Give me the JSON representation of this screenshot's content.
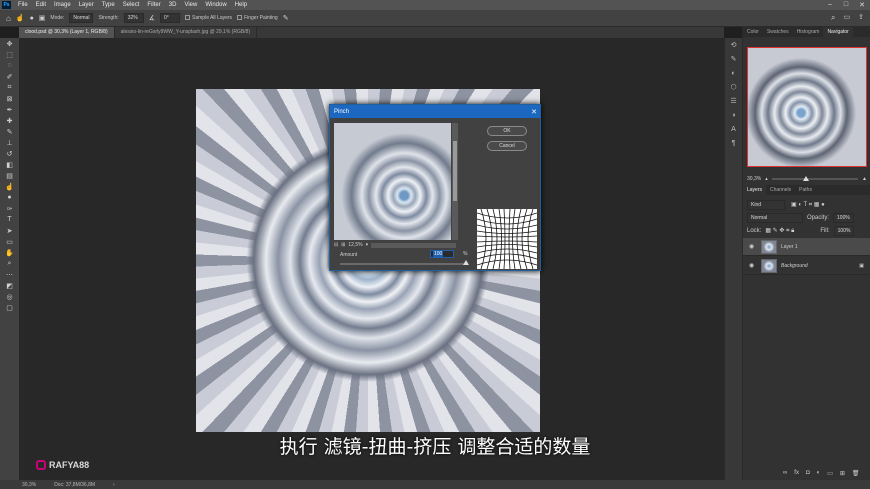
{
  "menubar": {
    "logo": "Ps",
    "items": [
      "File",
      "Edit",
      "Image",
      "Layer",
      "Type",
      "Select",
      "Filter",
      "3D",
      "View",
      "Window",
      "Help"
    ],
    "window_controls": [
      "–",
      "□",
      "✕"
    ]
  },
  "options": {
    "mode_label": "Mode:",
    "mode_value": "Normal",
    "strength_label": "Strength:",
    "strength_value": "32%",
    "angle_value": "0°",
    "sample_all_layers": "Sample All Layers",
    "finger_painting": "Finger Painting"
  },
  "tabs": [
    {
      "label": "clood.psd @ 30,3% (Layer 1, RGB/8)",
      "active": true
    },
    {
      "label": "alessio-lin-reGsrly9WW_Y-unsplash.jpg @ 29,1% (RGB/8)",
      "active": false
    }
  ],
  "panels": {
    "top_tabs": [
      "Color",
      "Swatches",
      "Histogram",
      "Navigator"
    ],
    "navigator_zoom": "30,3%",
    "navigator_zoom_fraction": 0.4,
    "layer_tabs": [
      "Layers",
      "Channels",
      "Paths"
    ],
    "kind": "Kind",
    "blend": "Normal",
    "opacity_label": "Opacity:",
    "opacity": "100%",
    "lock_label": "Lock:",
    "fill_label": "Fill:",
    "fill": "100%",
    "layers": [
      {
        "name": "Layer 1"
      },
      {
        "name": "Background"
      }
    ]
  },
  "dialog": {
    "title": "Pinch",
    "ok": "OK",
    "cancel": "Cancel",
    "preview_zoom": "12,5%",
    "amount_label": "Amount",
    "amount_value": "100",
    "amount_unit": "%",
    "amount_fraction": 1.0
  },
  "status": {
    "zoom": "30,3%",
    "doc": "Doc: 37,8M/36,8M"
  },
  "subtitle": "执行 滤镜-扭曲-挤压 调整合适的数量",
  "watermark": "RAFYA88"
}
